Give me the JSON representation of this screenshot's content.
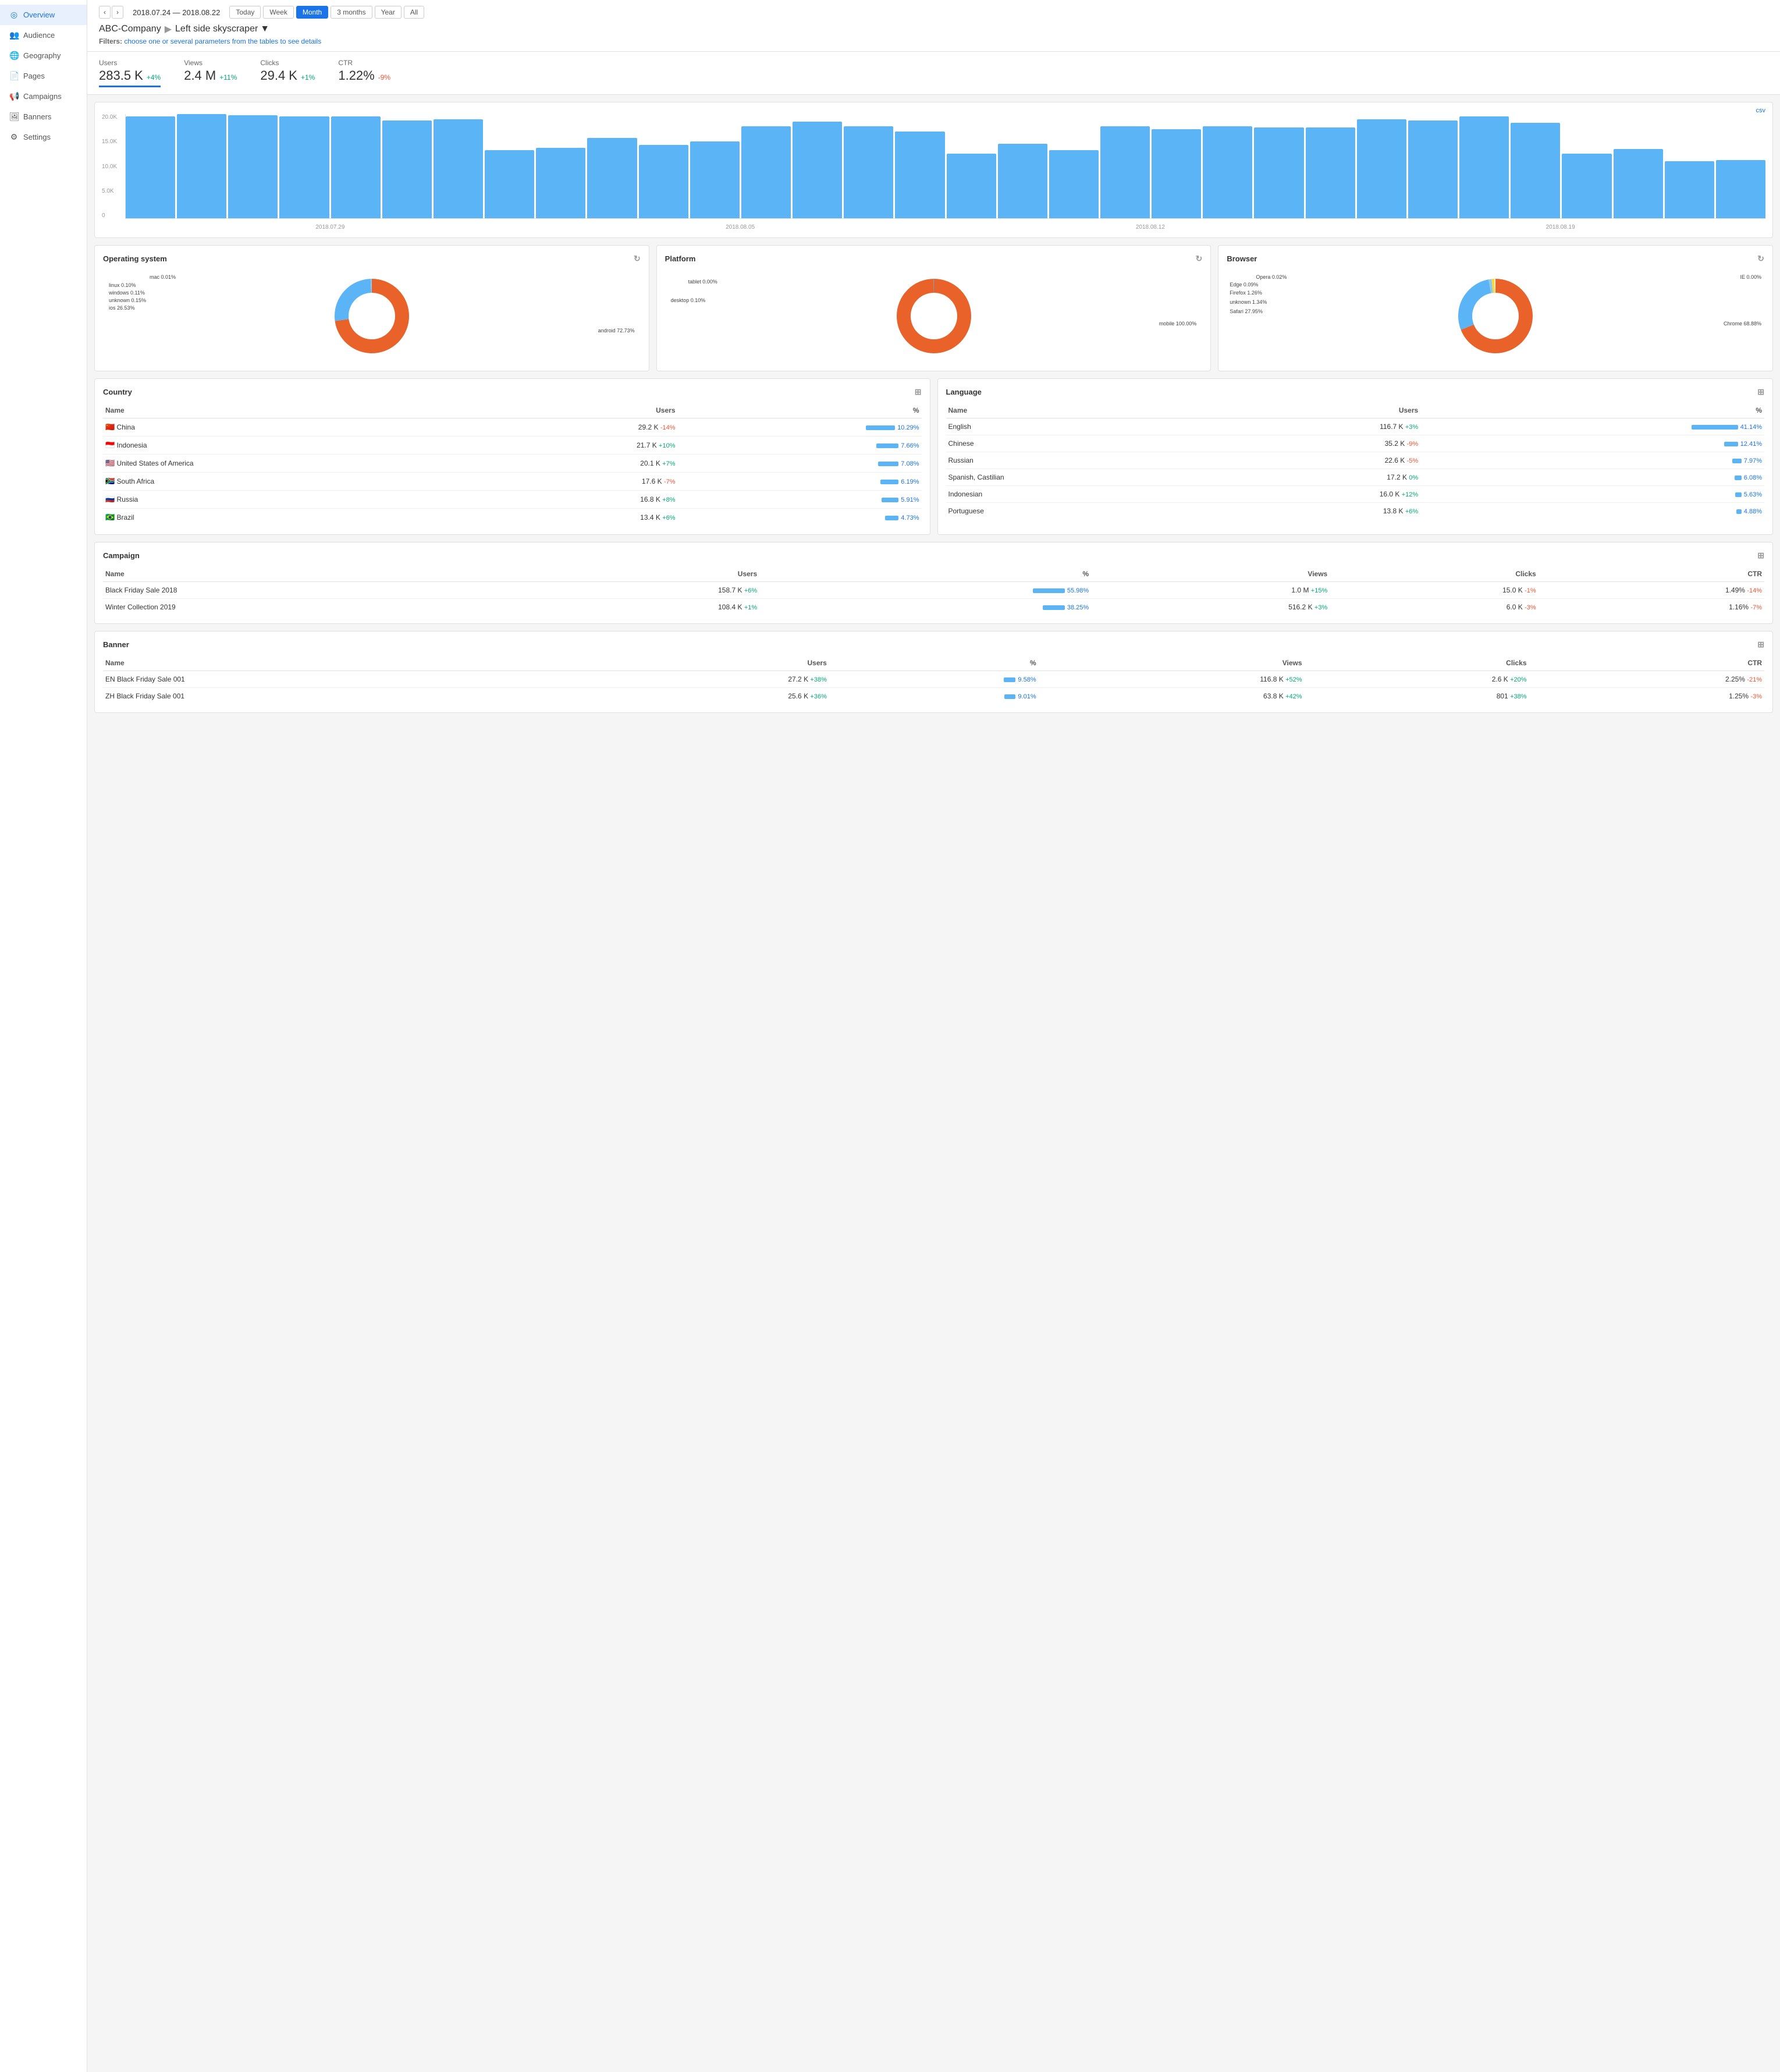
{
  "sidebar": {
    "items": [
      {
        "id": "overview",
        "label": "Overview",
        "icon": "◎",
        "active": true
      },
      {
        "id": "audience",
        "label": "Audience",
        "icon": "👥",
        "active": false
      },
      {
        "id": "geography",
        "label": "Geography",
        "icon": "🌐",
        "active": false
      },
      {
        "id": "pages",
        "label": "Pages",
        "icon": "📄",
        "active": false
      },
      {
        "id": "campaigns",
        "label": "Campaigns",
        "icon": "📢",
        "active": false
      },
      {
        "id": "banners",
        "label": "Banners",
        "icon": "🖼",
        "active": false
      },
      {
        "id": "settings",
        "label": "Settings",
        "icon": "⚙",
        "active": false
      }
    ]
  },
  "header": {
    "dateRange": "2018.07.24 — 2018.08.22",
    "periods": [
      "Today",
      "Week",
      "Month",
      "3 months",
      "Year",
      "All"
    ],
    "activePeriod": "Month",
    "breadcrumb": {
      "company": "ABC-Company",
      "page": "Left side skyscraper"
    },
    "filters": "choose one or several parameters from the tables to see details"
  },
  "stats": [
    {
      "label": "Users",
      "value": "283.5 K",
      "change": "+4%",
      "positive": true,
      "underline": true
    },
    {
      "label": "Views",
      "value": "2.4 M",
      "change": "+11%",
      "positive": true,
      "underline": false
    },
    {
      "label": "Clicks",
      "value": "29.4 K",
      "change": "+1%",
      "positive": true,
      "underline": false
    },
    {
      "label": "CTR",
      "value": "1.22%",
      "change": "-9%",
      "positive": false,
      "underline": false
    }
  ],
  "chart": {
    "csvLabel": "csv",
    "yLabels": [
      "20.0K",
      "15.0K",
      "10.0K",
      "5.0K",
      "0"
    ],
    "xLabels": [
      "2018.07.29",
      "2018.08.05",
      "2018.08.12",
      "2018.08.19"
    ],
    "bars": [
      82,
      84,
      83,
      82,
      82,
      79,
      80,
      55,
      57,
      65,
      59,
      62,
      74,
      78,
      74,
      70,
      52,
      60,
      55,
      74,
      72,
      74,
      73,
      73,
      80,
      79,
      82,
      77,
      52,
      56,
      46,
      47
    ]
  },
  "donutCharts": [
    {
      "title": "Operating system",
      "segments": [
        {
          "label": "android 72.73%",
          "pct": 72.73,
          "color": "#e8622a",
          "position": "right"
        },
        {
          "label": "ios 26.53%",
          "pct": 26.53,
          "color": "#5ab4f5",
          "position": "left"
        },
        {
          "label": "unknown 0.15%",
          "pct": 0.15,
          "color": "#a0c4e8",
          "position": "left"
        },
        {
          "label": "windows 0.11%",
          "pct": 0.11,
          "color": "#7abde0",
          "position": "left"
        },
        {
          "label": "linux 0.10%",
          "pct": 0.1,
          "color": "#90c8e8",
          "position": "left"
        },
        {
          "label": "mac 0.01%",
          "pct": 0.01,
          "color": "#b0d8f0",
          "position": "left"
        }
      ]
    },
    {
      "title": "Platform",
      "segments": [
        {
          "label": "mobile 100.00%",
          "pct": 99.9,
          "color": "#e8622a",
          "position": "right"
        },
        {
          "label": "desktop 0.10%",
          "pct": 0.1,
          "color": "#5ab4f5",
          "position": "left"
        },
        {
          "label": "tablet 0.00%",
          "pct": 0.01,
          "color": "#a0c4e8",
          "position": "left"
        }
      ]
    },
    {
      "title": "Browser",
      "segments": [
        {
          "label": "Chrome 68.88%",
          "pct": 68.88,
          "color": "#e8622a",
          "position": "right"
        },
        {
          "label": "Safari 27.95%",
          "pct": 27.95,
          "color": "#5ab4f5",
          "position": "left"
        },
        {
          "label": "unknown 1.34%",
          "pct": 1.34,
          "color": "#90c8e8",
          "position": "left"
        },
        {
          "label": "Firefox 1.26%",
          "pct": 1.26,
          "color": "#fdd835",
          "position": "left"
        },
        {
          "label": "Edge 0.09%",
          "pct": 0.09,
          "color": "#b0d8f0",
          "position": "left"
        },
        {
          "label": "Opera 0.02%",
          "pct": 0.02,
          "color": "#c8e8f8",
          "position": "left"
        },
        {
          "label": "IE 0.00%",
          "pct": 0.01,
          "color": "#d8eef8",
          "position": "right-top"
        }
      ]
    }
  ],
  "countryTable": {
    "title": "Country",
    "columns": [
      "Name",
      "Users",
      "%"
    ],
    "rows": [
      {
        "flag": "🇨🇳",
        "name": "China",
        "users": "29.2 K",
        "change": "-14%",
        "positive": false,
        "pct": "10.29%",
        "barWidth": 50
      },
      {
        "flag": "🇮🇩",
        "name": "Indonesia",
        "users": "21.7 K",
        "change": "+10%",
        "positive": true,
        "pct": "7.66%",
        "barWidth": 38
      },
      {
        "flag": "🇺🇸",
        "name": "United States of America",
        "users": "20.1 K",
        "change": "+7%",
        "positive": true,
        "pct": "7.08%",
        "barWidth": 35
      },
      {
        "flag": "🇿🇦",
        "name": "South Africa",
        "users": "17.6 K",
        "change": "-7%",
        "positive": false,
        "pct": "6.19%",
        "barWidth": 31
      },
      {
        "flag": "🇷🇺",
        "name": "Russia",
        "users": "16.8 K",
        "change": "+8%",
        "positive": true,
        "pct": "5.91%",
        "barWidth": 29
      },
      {
        "flag": "🇧🇷",
        "name": "Brazil",
        "users": "13.4 K",
        "change": "+6%",
        "positive": true,
        "pct": "4.73%",
        "barWidth": 23
      }
    ]
  },
  "languageTable": {
    "title": "Language",
    "columns": [
      "Name",
      "Users",
      "%"
    ],
    "rows": [
      {
        "name": "English",
        "users": "116.7 K",
        "change": "+3%",
        "positive": true,
        "pct": "41.14%",
        "barWidth": 80
      },
      {
        "name": "Chinese",
        "users": "35.2 K",
        "change": "-9%",
        "positive": false,
        "pct": "12.41%",
        "barWidth": 24
      },
      {
        "name": "Russian",
        "users": "22.6 K",
        "change": "-5%",
        "positive": false,
        "pct": "7.97%",
        "barWidth": 16
      },
      {
        "name": "Spanish, Castilian",
        "users": "17.2 K",
        "change": "0%",
        "positive": true,
        "pct": "6.08%",
        "barWidth": 12
      },
      {
        "name": "Indonesian",
        "users": "16.0 K",
        "change": "+12%",
        "positive": true,
        "pct": "5.63%",
        "barWidth": 11
      },
      {
        "name": "Portuguese",
        "users": "13.8 K",
        "change": "+6%",
        "positive": true,
        "pct": "4.88%",
        "barWidth": 9
      }
    ]
  },
  "campaignTable": {
    "title": "Campaign",
    "columns": [
      "Name",
      "Users",
      "%",
      "Views",
      "Clicks",
      "CTR"
    ],
    "rows": [
      {
        "name": "Black Friday Sale 2018",
        "users": "158.7 K",
        "change": "+6%",
        "positive": true,
        "pct": "55.98%",
        "barWidth": 55,
        "views": "1.0 M",
        "viewsChange": "+15%",
        "viewsPos": true,
        "clicks": "15.0 K",
        "clicksChange": "-1%",
        "clicksPos": false,
        "ctr": "1.49%",
        "ctrChange": "-14%",
        "ctrPos": false
      },
      {
        "name": "Winter Collection 2019",
        "users": "108.4 K",
        "change": "+1%",
        "positive": true,
        "pct": "38.25%",
        "barWidth": 38,
        "views": "516.2 K",
        "viewsChange": "+3%",
        "viewsPos": true,
        "clicks": "6.0 K",
        "clicksChange": "-3%",
        "clicksPos": false,
        "ctr": "1.16%",
        "ctrChange": "-7%",
        "ctrPos": false
      }
    ]
  },
  "bannerTable": {
    "title": "Banner",
    "columns": [
      "Name",
      "Users",
      "%",
      "Views",
      "Clicks",
      "CTR"
    ],
    "rows": [
      {
        "name": "EN Black Friday Sale 001",
        "users": "27.2 K",
        "change": "+38%",
        "positive": true,
        "pct": "9.58%",
        "barWidth": 20,
        "views": "116.8 K",
        "viewsChange": "+52%",
        "viewsPos": true,
        "clicks": "2.6 K",
        "clicksChange": "+20%",
        "clicksPos": true,
        "ctr": "2.25%",
        "ctrChange": "-21%",
        "ctrPos": false
      },
      {
        "name": "ZH Black Friday Sale 001",
        "users": "25.6 K",
        "change": "+36%",
        "positive": true,
        "pct": "9.01%",
        "barWidth": 19,
        "views": "63.8 K",
        "viewsChange": "+42%",
        "viewsPos": true,
        "clicks": "801",
        "clicksChange": "+38%",
        "clicksPos": true,
        "ctr": "1.25%",
        "ctrChange": "-3%",
        "ctrPos": false
      }
    ]
  }
}
